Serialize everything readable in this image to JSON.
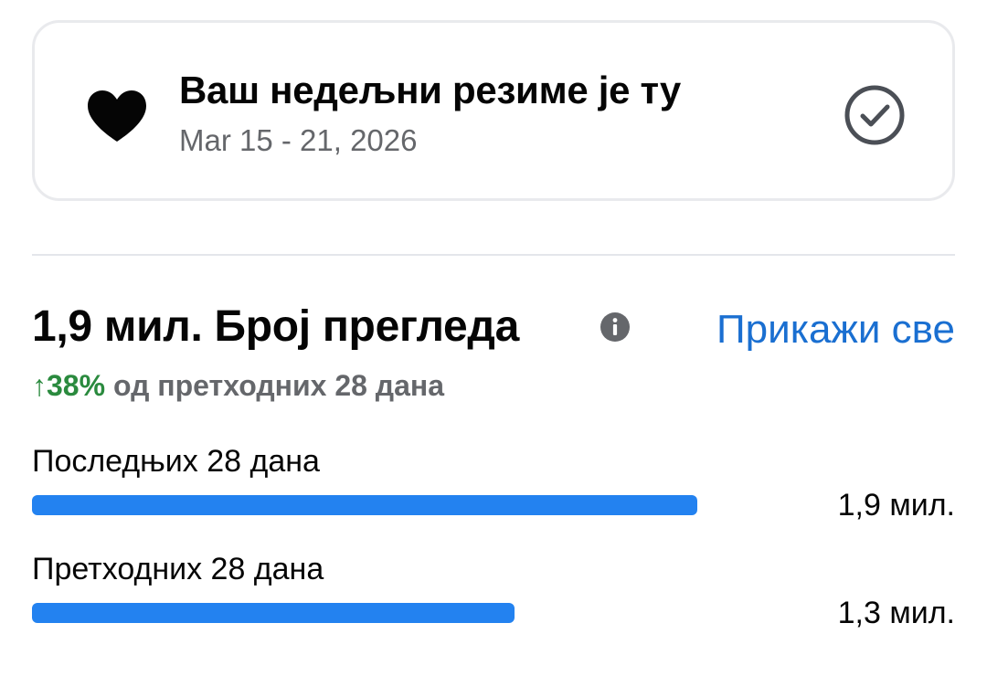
{
  "summary_card": {
    "title": "Ваш недељни резиме је ту",
    "date_range": "Mar 15 - 21, 2026",
    "heart_icon": "heart-icon",
    "check_icon": "check-circle-icon"
  },
  "views": {
    "title": "1,9 мил. Број прегледа",
    "info_icon": "info-icon",
    "see_all_label": "Прикажи све",
    "change_value": "↑38%",
    "change_text": " од претходних 28 дана",
    "change_color": "#2a8a3e",
    "link_color": "#1a6fd1",
    "bar_color": "#2382f0",
    "periods": [
      {
        "label": "Последњих 28 дана",
        "value_text": "1,9 мил.",
        "value": 1.9,
        "bar_fraction": 0.91
      },
      {
        "label": "Претходних 28 дана",
        "value_text": "1,3 мил.",
        "value": 1.3,
        "bar_fraction": 0.66
      }
    ]
  }
}
